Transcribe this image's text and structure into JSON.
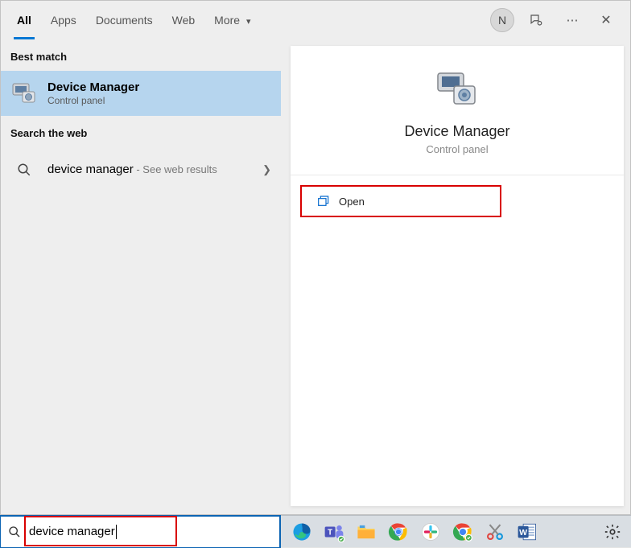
{
  "tabs": {
    "all": "All",
    "apps": "Apps",
    "documents": "Documents",
    "web": "Web",
    "more": "More"
  },
  "avatar_initial": "N",
  "groups": {
    "best_match": "Best match",
    "search_web": "Search the web"
  },
  "best_match": {
    "title": "Device Manager",
    "subtitle": "Control panel"
  },
  "web_result": {
    "query": "device manager",
    "suffix": " - See web results"
  },
  "preview": {
    "title": "Device Manager",
    "subtitle": "Control panel",
    "open_label": "Open"
  },
  "search": {
    "value": "device manager"
  }
}
